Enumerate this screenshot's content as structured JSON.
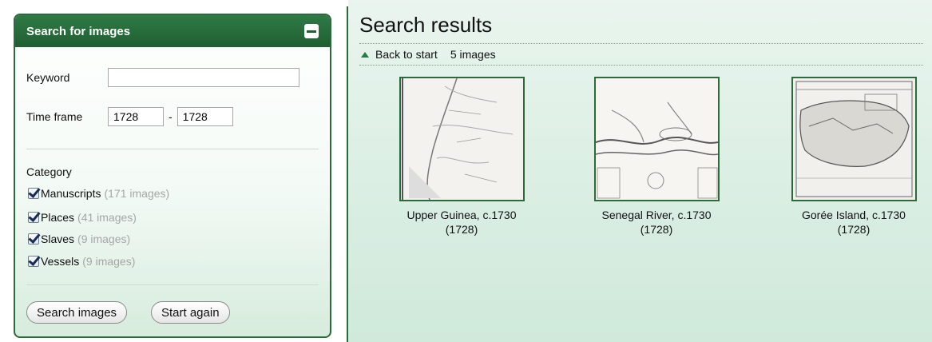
{
  "search_panel": {
    "title": "Search for images",
    "keyword_label": "Keyword",
    "keyword_value": "",
    "timeframe_label": "Time frame",
    "timeframe_from": "1728",
    "timeframe_sep": "-",
    "timeframe_to": "1728",
    "category_label": "Category",
    "categories": [
      {
        "label": "Manuscripts",
        "count": "(171 images)",
        "checked": true
      },
      {
        "label": "Places",
        "count": "(41 images)",
        "checked": true
      },
      {
        "label": "Slaves",
        "count": "(9 images)",
        "checked": true
      },
      {
        "label": "Vessels",
        "count": "(9 images)",
        "checked": true
      }
    ],
    "search_button": "Search images",
    "reset_button": "Start again"
  },
  "results": {
    "title": "Search results",
    "back_link": "Back to start",
    "count": "5 images",
    "items": [
      {
        "title": "Upper Guinea, c.1730",
        "year": "(1728)"
      },
      {
        "title": "Senegal River, c.1730",
        "year": "(1728)"
      },
      {
        "title": "Gorée Island, c.1730",
        "year": "(1728)"
      }
    ]
  },
  "colors": {
    "accent": "#2a6a3b",
    "background": "#d6ecdd"
  }
}
